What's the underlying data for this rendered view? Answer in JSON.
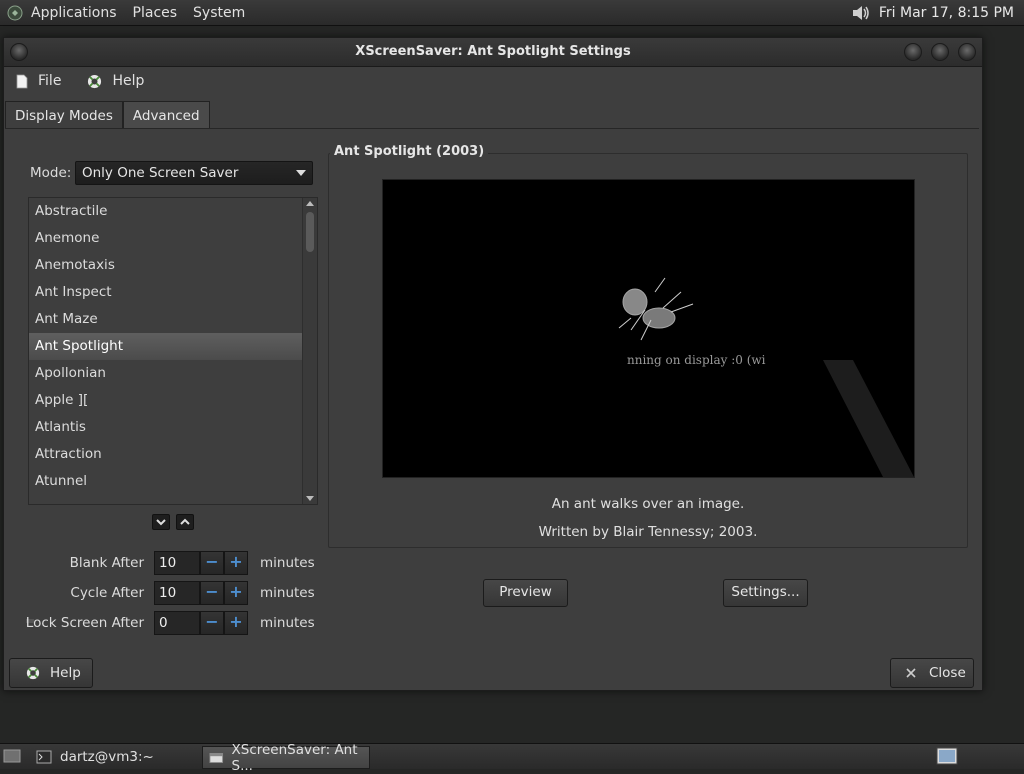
{
  "top_panel": {
    "menus": [
      "Applications",
      "Places",
      "System"
    ],
    "clock": "Fri Mar 17,  8:15 PM",
    "volume_icon": "volume-icon"
  },
  "window": {
    "title": "XScreenSaver: Ant Spotlight Settings",
    "menu": {
      "file": "File",
      "help": "Help"
    },
    "tabs": [
      "Display Modes",
      "Advanced"
    ],
    "mode": {
      "label": "Mode:",
      "value": "Only One Screen Saver"
    },
    "savers": [
      "Abstractile",
      "Anemone",
      "Anemotaxis",
      "Ant Inspect",
      "Ant Maze",
      "Ant Spotlight",
      "Apollonian",
      "Apple ][",
      "Atlantis",
      "Attraction",
      "Atunnel"
    ],
    "selected_saver": "Ant Spotlight",
    "blank_after": {
      "label": "Blank After",
      "value": "10",
      "unit": "minutes"
    },
    "cycle_after": {
      "label": "Cycle After",
      "value": "10",
      "unit": "minutes"
    },
    "lock_after": {
      "label": "Lock Screen After",
      "value": "0",
      "unit": "minutes"
    },
    "frame_title": "Ant Spotlight (2003)",
    "preview_text": "nning on display :0 (wi",
    "description": "An ant walks over an image.",
    "author": "Written by Blair Tennessy; 2003.",
    "preview_button": "Preview",
    "settings_button": "Settings...",
    "help_button": "Help",
    "close_button": "Close"
  },
  "taskbar": {
    "items": [
      "dartz@vm3:~",
      "XScreenSaver: Ant S..."
    ]
  },
  "colors": {
    "accent": "#4d8ecf",
    "background": "#3e3e3e",
    "desktop": "#252625"
  }
}
